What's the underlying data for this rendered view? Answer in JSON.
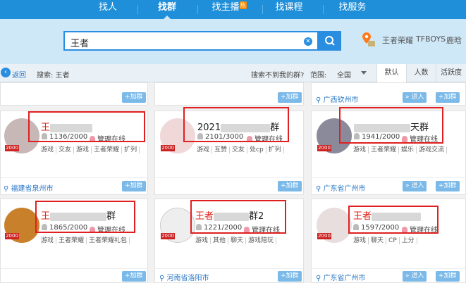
{
  "nav": {
    "tabs": [
      "找人",
      "找群",
      "找主播",
      "找课程",
      "找服务"
    ],
    "hot_badge": "热"
  },
  "search": {
    "value": "王者",
    "hot_keywords": [
      "王者荣耀",
      "TFBOYS",
      "鹿晗"
    ]
  },
  "filter": {
    "back_label": "返回",
    "search_label": "搜索: 王者",
    "not_found": "搜索不到我的群?",
    "range_label": "范围:",
    "range_value": "全国",
    "sort_tabs": [
      "默认",
      "人数",
      "活跃度"
    ]
  },
  "buttons": {
    "join": "+加群",
    "enter": "» 进入"
  },
  "top_row": {
    "location": "广西钦州市"
  },
  "groups": [
    {
      "name_prefix": "王",
      "name_suffix": "",
      "count": "1136/2000",
      "status": "管理在线",
      "tags": [
        "游戏",
        "交友",
        "游戏",
        "王者荣耀",
        "扩列"
      ],
      "level": "2000",
      "location": "福建省泉州市"
    },
    {
      "name_prefix": "2021",
      "name_suffix": "群",
      "count": "2101/3000",
      "status": "管理在线",
      "tags": [
        "游戏",
        "互赞",
        "交友",
        "处cp",
        "扩列"
      ],
      "level": "2000",
      "location": ""
    },
    {
      "name_prefix": "",
      "name_suffix": "天群",
      "count": "1941/2000",
      "status": "管理在线",
      "tags": [
        "游戏",
        "王者荣耀",
        "娱乐",
        "游戏交流"
      ],
      "level": "2000",
      "location": "广东省广州市"
    },
    {
      "name_prefix": "王",
      "name_suffix": "群",
      "count": "1865/2000",
      "status": "管理在线",
      "tags": [
        "游戏",
        "王者荣耀",
        "王者荣耀礼包"
      ],
      "level": "2000",
      "location": ""
    },
    {
      "name_prefix": "王者",
      "name_suffix": "群2",
      "count": "1221/2000",
      "status": "管理在线",
      "tags": [
        "游戏",
        "其他",
        "聊天",
        "游戏陪玩"
      ],
      "level": "2000",
      "location": "河南省洛阳市"
    },
    {
      "name_prefix": "王者",
      "name_suffix": "",
      "count": "1597/2000",
      "status": "管理在线",
      "tags": [
        "游戏",
        "聊天",
        "CP",
        "上分"
      ],
      "level": "2000",
      "location": "广东省广州市"
    }
  ],
  "colors": {
    "nav_bg": "#1f8fd9",
    "accent": "#2a8ee0",
    "highlight": "#e02020"
  }
}
